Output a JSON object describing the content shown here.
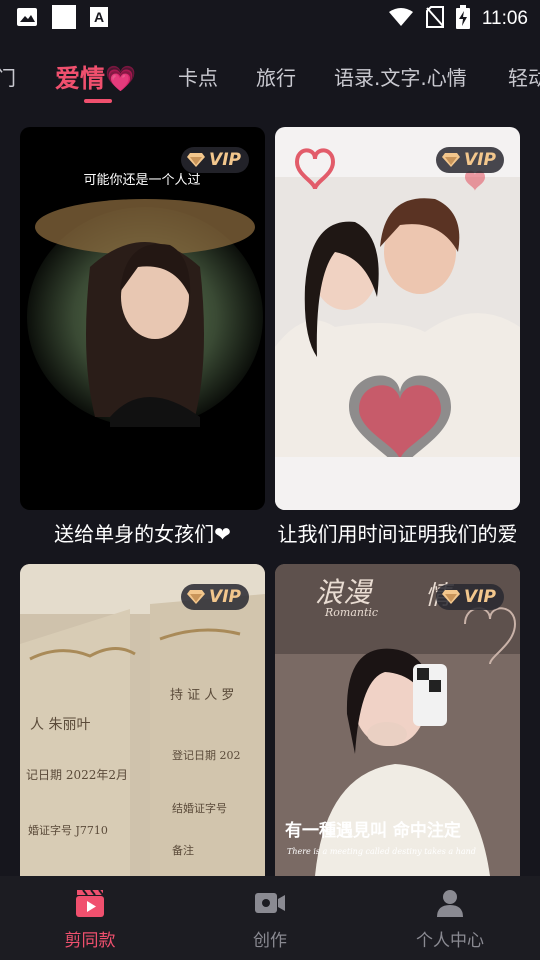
{
  "status_bar": {
    "time": "11:06",
    "icons": [
      "image-icon",
      "blank-square-icon",
      "font-icon",
      "wifi-icon",
      "no-sim-icon",
      "battery-charging-icon"
    ]
  },
  "tabs": {
    "items": [
      {
        "label": "门",
        "active": false
      },
      {
        "label": "爱情💗",
        "active": true
      },
      {
        "label": "卡点",
        "active": false
      },
      {
        "label": "旅行",
        "active": false
      },
      {
        "label": "语录.文字.心情",
        "active": false
      },
      {
        "label": "轻动",
        "active": false
      }
    ]
  },
  "templates": [
    {
      "title": "送给单身的女孩们❤",
      "badge": "VIP",
      "overlay_text": "可能你还是一个人过"
    },
    {
      "title": "让我们用时间证明我们的爱",
      "badge": "VIP"
    },
    {
      "title": "",
      "badge": "VIP",
      "overlay_lines": [
        "人 朱丽叶",
        "记日期 2022年2月",
        "婚证字号 J7710",
        "持 证 人 罗",
        "登记日期 202",
        "结婚证字号",
        "备注"
      ]
    },
    {
      "title": "",
      "badge": "VIP",
      "overlay_top": "浪漫",
      "overlay_top2": "情",
      "overlay_small": "Romantic",
      "overlay_bottom": "有一種遇見叫 命中注定",
      "overlay_en": "There is a meeting called destiny takes a hand"
    }
  ],
  "bottom_nav": {
    "items": [
      {
        "label": "剪同款",
        "icon": "clapperboard-icon",
        "active": true
      },
      {
        "label": "创作",
        "icon": "video-camera-icon",
        "active": false
      },
      {
        "label": "个人中心",
        "icon": "person-icon",
        "active": false
      }
    ]
  },
  "colors": {
    "accent": "#f0506e",
    "background": "#16161d",
    "vip_gold": "#f3c78d",
    "nav_bg": "#1c1c22"
  }
}
